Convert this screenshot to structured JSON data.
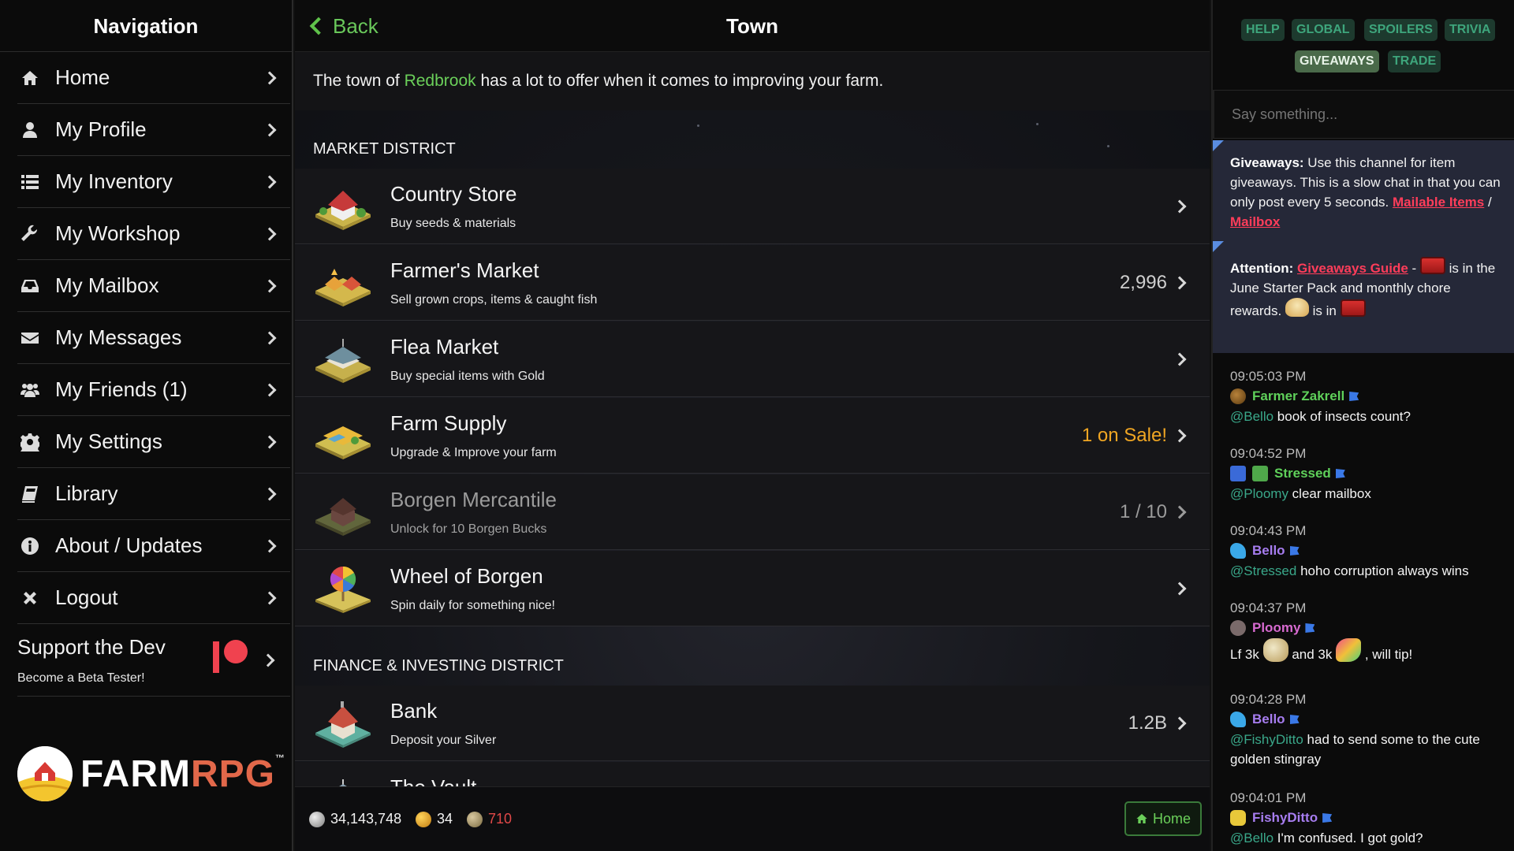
{
  "sidebar": {
    "title": "Navigation",
    "items": [
      {
        "label": "Home",
        "icon": "home-icon"
      },
      {
        "label": "My Profile",
        "icon": "user-icon"
      },
      {
        "label": "My Inventory",
        "icon": "list-icon"
      },
      {
        "label": "My Workshop",
        "icon": "wrench-icon"
      },
      {
        "label": "My Mailbox",
        "icon": "inbox-icon"
      },
      {
        "label": "My Messages",
        "icon": "envelope-icon"
      },
      {
        "label": "My Friends (1)",
        "icon": "users-icon"
      },
      {
        "label": "My Settings",
        "icon": "gear-icon"
      },
      {
        "label": "Library",
        "icon": "book-icon"
      },
      {
        "label": "About / Updates",
        "icon": "info-icon"
      },
      {
        "label": "Logout",
        "icon": "close-icon"
      }
    ],
    "support": {
      "title": "Support the Dev",
      "subtitle": "Become a Beta Tester!",
      "icon": "patreon-icon"
    },
    "logo": {
      "text_a": "FARM",
      "text_b": "RPG",
      "tm": "™"
    }
  },
  "main": {
    "back_label": "Back",
    "title": "Town",
    "intro": {
      "before": "The town of ",
      "town": "Redbrook",
      "after": " has a lot to offer when it comes to improving your farm."
    },
    "sections": [
      {
        "heading": "Market District",
        "rows": [
          {
            "title": "Country Store",
            "subtitle": "Buy seeds & materials",
            "value": "",
            "locked": false,
            "sale": false
          },
          {
            "title": "Farmer's Market",
            "subtitle": "Sell grown crops, items & caught fish",
            "value": "2,996",
            "locked": false,
            "sale": false
          },
          {
            "title": "Flea Market",
            "subtitle": "Buy special items with Gold",
            "value": "",
            "locked": false,
            "sale": false
          },
          {
            "title": "Farm Supply",
            "subtitle": "Upgrade & Improve your farm",
            "value": "1 on Sale!",
            "locked": false,
            "sale": true
          },
          {
            "title": "Borgen Mercantile",
            "subtitle": "Unlock for 10 Borgen Bucks",
            "value": "1 / 10",
            "locked": true,
            "sale": false
          },
          {
            "title": "Wheel of Borgen",
            "subtitle": "Spin daily for something nice!",
            "value": "",
            "locked": false,
            "sale": false
          }
        ]
      },
      {
        "heading": "Finance & Investing District",
        "rows": [
          {
            "title": "Bank",
            "subtitle": "Deposit your Silver",
            "value": "1.2B",
            "locked": false,
            "sale": false
          },
          {
            "title": "The Vault",
            "subtitle": "",
            "value": "",
            "locked": false,
            "sale": false
          }
        ]
      }
    ],
    "bottom": {
      "silver": "34,143,748",
      "gold": "34",
      "ancient_coins": "710",
      "home_label": "Home"
    }
  },
  "chat": {
    "channels": [
      "HELP",
      "GLOBAL",
      "SPOILERS",
      "TRIVIA",
      "GIVEAWAYS",
      "TRADE"
    ],
    "active_channel": "GIVEAWAYS",
    "input_placeholder": "Say something...",
    "pinned": {
      "p1_label": "Giveaways:",
      "p1_text": " Use this channel for item giveaways. This is a slow chat in that you can only post every 5 seconds.",
      "p1_link1": "Mailable Items",
      "p1_sep": " / ",
      "p1_link2": "Mailbox",
      "p2_label": "Attention:",
      "p2_link": "Giveaways Guide",
      "p2_dash": " - ",
      "p2_text1": " is in the June Starter Pack and monthly chore rewards.",
      "p2_text2": " is in"
    },
    "messages": [
      {
        "time": "09:05:03 PM",
        "user": "Farmer Zakrell",
        "color": "#5fd05a",
        "mention": "@Bello",
        "text": " book of insects count?"
      },
      {
        "time": "09:04:52 PM",
        "user": "Stressed",
        "color": "#5fd05a",
        "mention": "@Ploomy",
        "text": " clear mailbox"
      },
      {
        "time": "09:04:43 PM",
        "user": "Bello",
        "color": "#a77df0",
        "mention": "@Stressed",
        "text": " hoho corruption always wins"
      },
      {
        "time": "09:04:37 PM",
        "user": "Ploomy",
        "color": "#d76ad0",
        "mention": "",
        "text_a": "Lf 3k ",
        "text_b": " and 3k ",
        "text_c": " , will tip!"
      },
      {
        "time": "09:04:28 PM",
        "user": "Bello",
        "color": "#a77df0",
        "mention": "@FishyDitto",
        "text": " had to send some to the cute golden stingray"
      },
      {
        "time": "09:04:01 PM",
        "user": "FishyDitto",
        "color": "#a77df0",
        "mention": "@Bello",
        "text": " I'm confused. I got gold?"
      }
    ]
  },
  "colors": {
    "accent_green": "#69c75a",
    "sale_orange": "#f0a623",
    "link_red": "#ff3d5a",
    "mention_teal": "#3aa88a"
  }
}
